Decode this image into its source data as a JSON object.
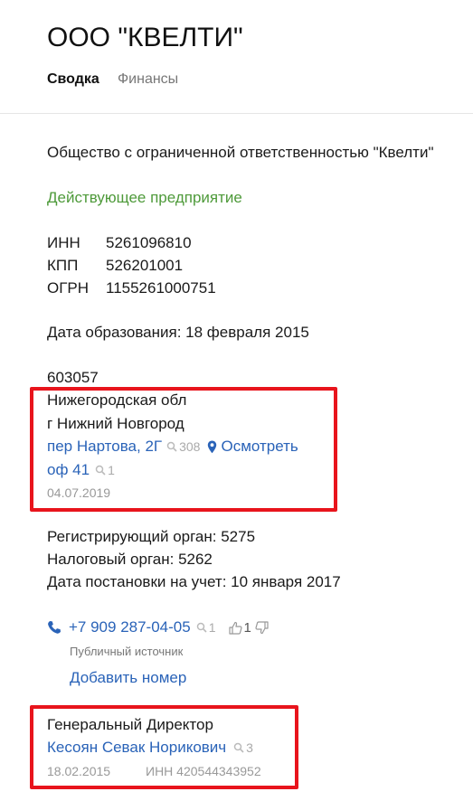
{
  "header": {
    "title": "ООО \"КВЕЛТИ\"",
    "tabs": [
      {
        "label": "Сводка",
        "active": true
      },
      {
        "label": "Финансы",
        "active": false
      }
    ]
  },
  "company": {
    "full_name": "Общество с ограниченной ответственностью \"Квелти\"",
    "status": "Действующее предприятие",
    "codes": [
      {
        "label": "ИНН",
        "value": "5261096810"
      },
      {
        "label": "КПП",
        "value": "526201001"
      },
      {
        "label": "ОГРН",
        "value": "1155261000751"
      }
    ],
    "founded": "Дата образования: 18 февраля 2015"
  },
  "address": {
    "postcode": "603057",
    "region": "Нижегородская обл",
    "city": "г Нижний Новгород",
    "street": "пер Нартова, 2Г",
    "street_count": "308",
    "view_label": "Осмотреть",
    "office": "оф 41",
    "office_count": "1",
    "date": "04.07.2019"
  },
  "registration": {
    "registrar": "Регистрирующий орган: 5275",
    "tax_authority": "Налоговый орган: 5262",
    "registered_on": "Дата постановки на учет: 10 января 2017"
  },
  "phone": {
    "number": "+7 909 287-04-05",
    "count": "1",
    "likes": "1",
    "source": "Публичный источник",
    "add_label": "Добавить номер"
  },
  "director": {
    "position": "Генеральный Директор",
    "name": "Кесоян Севак Норикович",
    "count": "3",
    "date": "18.02.2015",
    "inn": "ИНН 420544343952"
  },
  "colors": {
    "link": "#2a63b8",
    "status": "#4e9a3a",
    "highlight": "#e8141c"
  }
}
